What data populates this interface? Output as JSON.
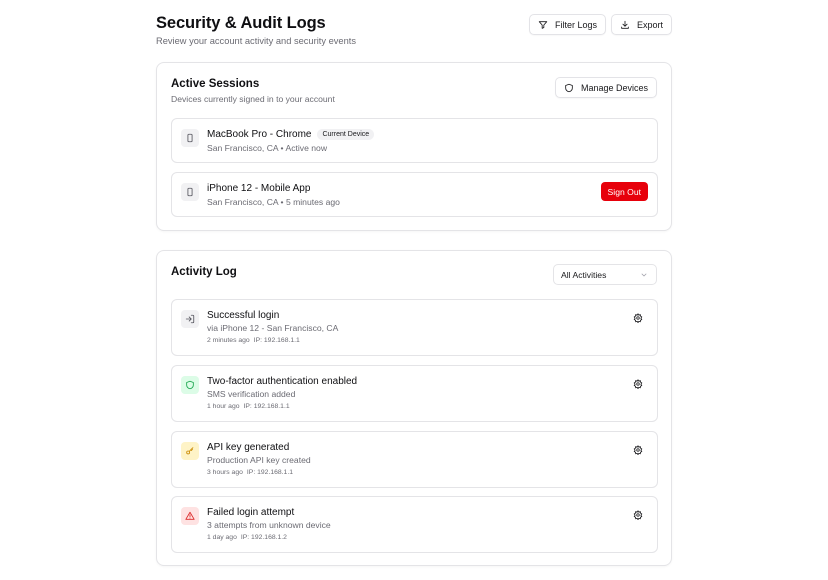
{
  "header": {
    "title": "Security & Audit Logs",
    "subtitle": "Review your account activity and security events",
    "filter_label": "Filter Logs",
    "export_label": "Export"
  },
  "sessions": {
    "title": "Active Sessions",
    "description": "Devices currently signed in to your account",
    "manage_label": "Manage Devices",
    "items": [
      {
        "name": "MacBook Pro - Chrome",
        "badge": "Current Device",
        "meta": "San Francisco, CA • Active now",
        "icon": "laptop-icon"
      },
      {
        "name": "iPhone 12 - Mobile App",
        "meta": "San Francisco, CA • 5 minutes ago",
        "action": "Sign Out",
        "icon": "phone-icon"
      }
    ]
  },
  "activity": {
    "title": "Activity Log",
    "filter_value": "All Activities",
    "items": [
      {
        "title": "Successful login",
        "desc": "via iPhone 12 - San Francisco, CA",
        "time": "2 minutes ago",
        "ip": "IP: 192.168.1.1",
        "icon": "login-icon",
        "icon_bg": "#f1f1f3",
        "icon_color": "#52525b"
      },
      {
        "title": "Two-factor authentication enabled",
        "desc": "SMS verification added",
        "time": "1 hour ago",
        "ip": "IP: 192.168.1.1",
        "icon": "shield-icon",
        "icon_bg": "#dcfce7",
        "icon_color": "#16a34a"
      },
      {
        "title": "API key generated",
        "desc": "Production API key created",
        "time": "3 hours ago",
        "ip": "IP: 192.168.1.1",
        "icon": "key-icon",
        "icon_bg": "#fef3c7",
        "icon_color": "#ca8a04"
      },
      {
        "title": "Failed login attempt",
        "desc": "3 attempts from unknown device",
        "time": "1 day ago",
        "ip": "IP: 192.168.1.2",
        "icon": "alert-triangle-icon",
        "icon_bg": "#fee2e2",
        "icon_color": "#dc2626"
      }
    ]
  },
  "colors": {
    "danger": "#e7000b",
    "border": "#e4e4e7",
    "muted_text": "#6b6b73"
  }
}
